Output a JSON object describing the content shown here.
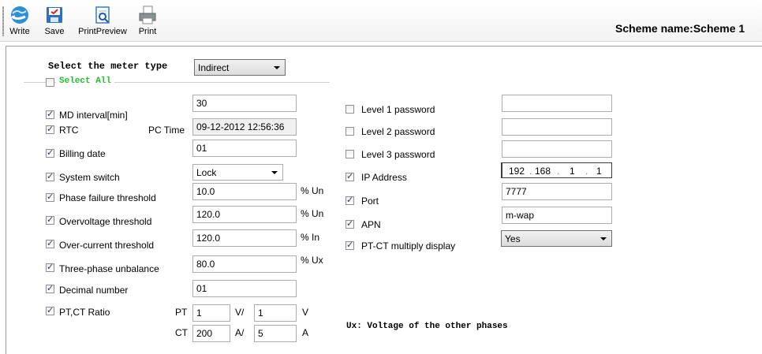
{
  "toolbar": {
    "write": {
      "label": "Write",
      "icon": "globe-refresh-icon"
    },
    "save": {
      "label": "Save",
      "icon": "save-disk-icon"
    },
    "print_preview": {
      "label": "PrintPreview",
      "icon": "print-preview-icon"
    },
    "print": {
      "label": "Print",
      "icon": "printer-icon"
    },
    "scheme_name": "Scheme name:Scheme  1"
  },
  "meter_type": {
    "label": "Select the meter type",
    "value": "Indirect"
  },
  "select_all": {
    "label": "Select All",
    "checked": false,
    "color": "#1ec02a"
  },
  "left": {
    "md_interval": {
      "label": "MD interval[min]",
      "checked": true,
      "value": "30"
    },
    "rtc": {
      "label": "RTC",
      "checked": true,
      "pc_time_label": "PC Time",
      "value": "09-12-2012 12:56:36"
    },
    "billing_date": {
      "label": "Billing date",
      "checked": true,
      "value": "01"
    },
    "system_switch": {
      "label": "System switch",
      "checked": true,
      "value": "Lock"
    },
    "phase_failure": {
      "label": "Phase failure threshold",
      "checked": true,
      "value": "10.0",
      "unit": "% Un"
    },
    "overvoltage": {
      "label": "Overvoltage threshold",
      "checked": true,
      "value": "120.0",
      "unit": "% Un"
    },
    "overcurrent": {
      "label": "Over-current threshold",
      "checked": true,
      "value": "120.0",
      "unit": "% In"
    },
    "unbalance": {
      "label": "Three-phase unbalance",
      "checked": true,
      "value": "80.0",
      "unit": "% Ux"
    },
    "decimal": {
      "label": "Decimal number",
      "checked": true,
      "value": "01"
    },
    "ratio": {
      "label": "PT,CT Ratio",
      "checked": true,
      "pt_label": "PT",
      "pt_primary": "1",
      "pt_sep": "V/",
      "pt_secondary": "1",
      "pt_unit": "V",
      "ct_label": "CT",
      "ct_primary": "200",
      "ct_sep": "A/",
      "ct_secondary": "5",
      "ct_unit": "A"
    }
  },
  "right": {
    "level1": {
      "label": "Level 1 password",
      "checked": false,
      "value": ""
    },
    "level2": {
      "label": "Level 2 password",
      "checked": false,
      "value": ""
    },
    "level3": {
      "label": "Level 3 password",
      "checked": false,
      "value": ""
    },
    "ip": {
      "label": "IP Address",
      "checked": true,
      "octets": [
        "192",
        "168",
        "1",
        "1"
      ]
    },
    "port": {
      "label": "Port",
      "checked": true,
      "value": "7777"
    },
    "apn": {
      "label": "APN",
      "checked": true,
      "value": "m-wap"
    },
    "multiply": {
      "label": "PT-CT multiply display",
      "checked": true,
      "value": "Yes"
    }
  },
  "note": "Ux: Voltage of the other phases"
}
